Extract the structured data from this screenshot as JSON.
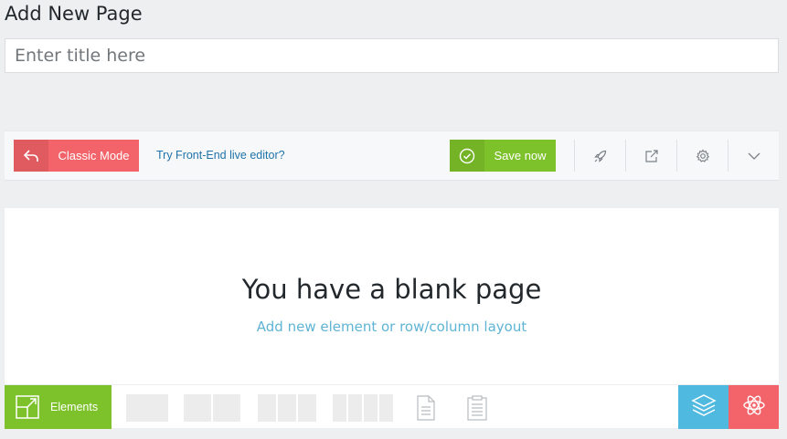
{
  "page": {
    "heading": "Add New Page"
  },
  "title_field": {
    "placeholder": "Enter title here",
    "value": ""
  },
  "toolbar": {
    "classic_mode_label": "Classic Mode",
    "frontend_link": "Try Front-End live editor?",
    "save_label": "Save now",
    "icons": [
      "rocket-icon",
      "share-icon",
      "gear-icon",
      "chevron-down-icon"
    ]
  },
  "canvas": {
    "title": "You have a blank page",
    "subtitle": "Add new element or row/column layout"
  },
  "bottom_bar": {
    "elements_label": "Elements",
    "layouts": [
      1,
      2,
      3,
      4
    ],
    "template_icons": [
      "document-icon",
      "clipboard-icon"
    ]
  },
  "colors": {
    "classic_red": "#f2646a",
    "save_green": "#7dc22b",
    "link_blue": "#1f72a9",
    "subtitle_blue": "#5fb4d4",
    "layers_blue": "#4fb9e0"
  }
}
